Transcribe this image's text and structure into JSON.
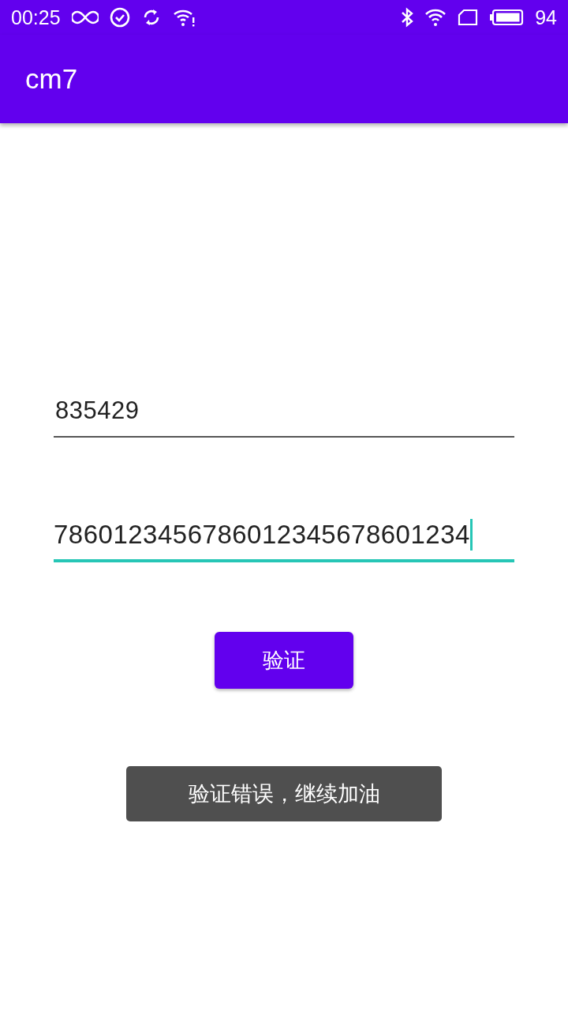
{
  "status_bar": {
    "time": "00:25",
    "battery": "94"
  },
  "app_bar": {
    "title": "cm7"
  },
  "fields": [
    {
      "value": "835429",
      "focused": false
    },
    {
      "value": "7860123456786012345678601234",
      "focused": true
    }
  ],
  "button": {
    "label": "验证"
  },
  "toast": {
    "text": "验证错误，继续加油"
  }
}
